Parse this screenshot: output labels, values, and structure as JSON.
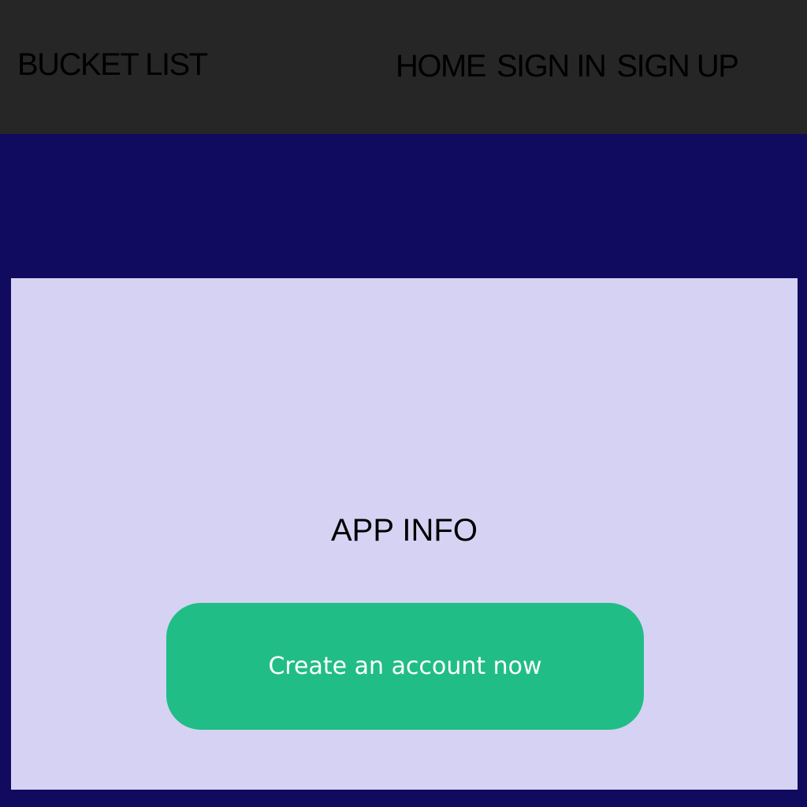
{
  "navbar": {
    "brand": "BUCKET LIST",
    "links": [
      {
        "label": "HOME"
      },
      {
        "label": "SIGN IN"
      },
      {
        "label": "SIGN UP"
      }
    ]
  },
  "main": {
    "heading": "APP INFO",
    "cta_label": "Create an account now"
  },
  "colors": {
    "page_background": "#100b5f",
    "navbar_background": "#262626",
    "card_background": "#d6d2f3",
    "cta_background": "#21bd87",
    "cta_text": "#ffffff"
  }
}
